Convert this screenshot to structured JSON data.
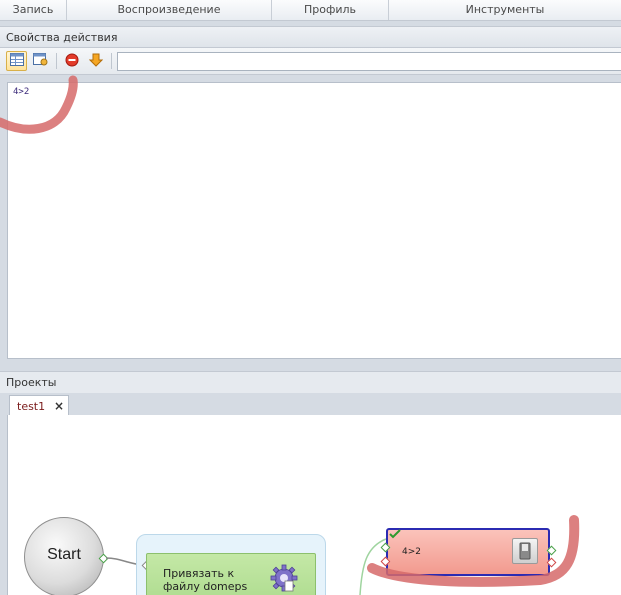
{
  "ribbon": {
    "tabs": [
      {
        "label": "Запись"
      },
      {
        "label": "Воспроизведение"
      },
      {
        "label": "Профиль"
      },
      {
        "label": "Инструменты"
      }
    ]
  },
  "properties_panel": {
    "title": "Свойства действия",
    "toolbar": {
      "buttons": [
        {
          "icon": "table-view-icon",
          "active": true
        },
        {
          "icon": "window-settings-icon",
          "active": false
        },
        {
          "icon": "red-stop-icon",
          "active": false
        },
        {
          "icon": "orange-down-arrow-icon",
          "active": false
        }
      ],
      "input_value": ""
    },
    "editor": {
      "content": "4>2"
    }
  },
  "projects_panel": {
    "title": "Проекты",
    "tabs": [
      {
        "label": "test1",
        "close": "×"
      }
    ],
    "canvas": {
      "start_node": {
        "label": "Start"
      },
      "green_action": {
        "label": "Привязать к файлу domeps"
      },
      "red_action": {
        "label": "4>2"
      }
    }
  },
  "colors": {
    "accent_border": "#2b2bb2",
    "red_action_fill": "#f29a8f",
    "green_action_fill": "#a9d98a",
    "annotation_stroke": "#d66a6a"
  }
}
